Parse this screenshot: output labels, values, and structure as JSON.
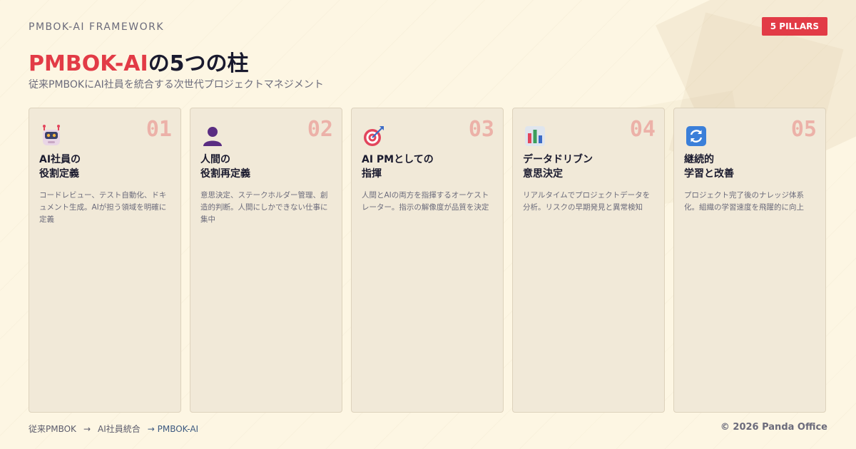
{
  "header": {
    "eyebrow": "PMBOK-AI FRAMEWORK",
    "badge": "5 PILLARS",
    "title_accent": "PMBOK-AI",
    "title_rest": "の5つの柱",
    "subtitle": "従来PMBOKにAI社員を統合する次世代プロジェクトマネジメント"
  },
  "cards": [
    {
      "num": "01",
      "icon": "robot-icon",
      "title": "AI社員の\n役割定義",
      "desc": "コードレビュー、テスト自動化、ドキュメント生成。AIが担う領域を明確に定義"
    },
    {
      "num": "02",
      "icon": "person-icon",
      "title": "人間の\n役割再定義",
      "desc": "意思決定、ステークホルダー管理、創造的判断。人間にしかできない仕事に集中"
    },
    {
      "num": "03",
      "icon": "target-icon",
      "title": "AI PMとしての\n指揮",
      "desc": "人間とAIの両方を指揮するオーケストレーター。指示の解像度が品質を決定"
    },
    {
      "num": "04",
      "icon": "bar-chart-icon",
      "title": "データドリブン\n意思決定",
      "desc": "リアルタイムでプロジェクトデータを分析。リスクの早期発見と異常検知"
    },
    {
      "num": "05",
      "icon": "refresh-icon",
      "title": "継続的\n学習と改善",
      "desc": "プロジェクト完了後のナレッジ体系化。組織の学習速度を飛躍的に向上"
    }
  ],
  "footer": {
    "flow": [
      "従来PMBOK",
      "→",
      "AI社員統合",
      "→ PMBOK-AI"
    ],
    "copyright": "© 2026 Panda Office"
  },
  "colors": {
    "accent": "#e23b46",
    "background": "#fdf6e3",
    "card": "#f1e9d8",
    "number": "#ecb1a8"
  }
}
